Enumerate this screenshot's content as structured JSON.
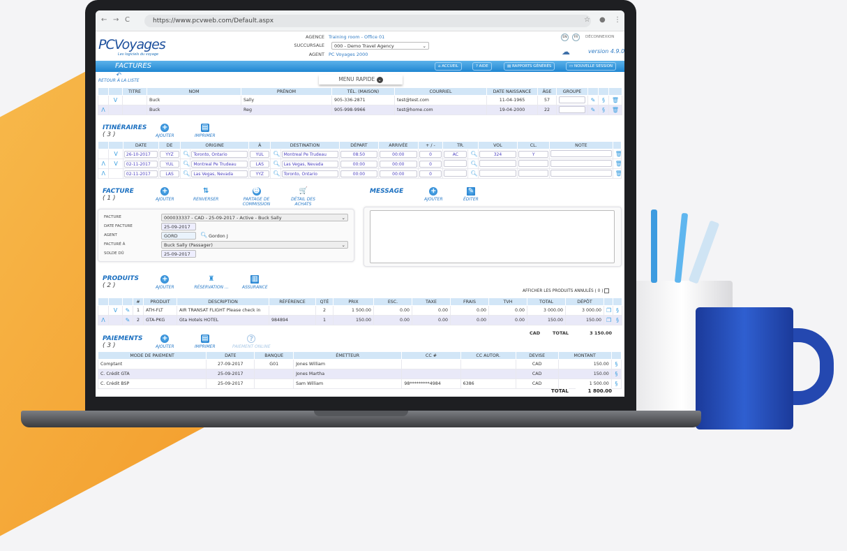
{
  "browser": {
    "url": "https://www.pcvweb.com/Default.aspx"
  },
  "header": {
    "logo": "PCVoyages",
    "tagline": "Les logiciels du voyage",
    "agence_label": "AGENCE",
    "agence": "Training room - Office 01",
    "succursale_label": "SUCCURSALE",
    "succursale": "000 - Demo Travel Agency",
    "agent_label": "AGENT",
    "agent": "PC Voyages 2000",
    "lang_en": "EN",
    "lang_fr": "FR",
    "logout": "DÉCONNEXION",
    "version": "version 4.9.0"
  },
  "bar": {
    "title": "FACTURES",
    "accueil": "ACCUEIL",
    "aide": "AIDE",
    "rapports": "RAPPORTS GÉNÉRÉS",
    "session": "NOUVELLE SESSION"
  },
  "back": "RETOUR À LA LISTE",
  "menu_rapide": "MENU RAPIDE",
  "passengers": {
    "headers": [
      "TITRE",
      "NOM",
      "PRÉNOM",
      "TÉL. (MAISON)",
      "COURRIEL",
      "DATE NAISSANCE",
      "ÂGE",
      "GROUPE"
    ],
    "rows": [
      [
        "",
        "Buck",
        "Sally",
        "905-336-2871",
        "test@test.com",
        "11-04-1965",
        "57"
      ],
      [
        "",
        "Buck",
        "Reg",
        "905-998-9966",
        "test@home.com",
        "19-04-2000",
        "22"
      ]
    ]
  },
  "itineraires": {
    "title": "ITINÉRAIRES",
    "count": "( 3 )",
    "add": "AJOUTER",
    "print": "IMPRIMER",
    "headers": [
      "DATE",
      "DE",
      "ORIGINE",
      "À",
      "DESTINATION",
      "DÉPART",
      "ARRIVÉE",
      "+ / -",
      "TR.",
      "VOL",
      "CL.",
      "NOTE"
    ],
    "rows": [
      [
        "26-10-2017",
        "YYZ",
        "Toronto, Ontario",
        "YUL",
        "Montreal Pe Trudeau",
        "08:50",
        "00:00",
        "0",
        "AC",
        "324",
        "Y",
        ""
      ],
      [
        "02-11-2017",
        "YUL",
        "Montreal Pe Trudeau",
        "LAS",
        "Las Vegas, Nevada",
        "00:00",
        "00:00",
        "0",
        "",
        "",
        "",
        ""
      ],
      [
        "02-11-2017",
        "LAS",
        "Las Vegas, Nevada",
        "YYZ",
        "Toronto, Ontario",
        "00:00",
        "00:00",
        "0",
        "",
        "",
        "",
        ""
      ]
    ]
  },
  "facture": {
    "title": "FACTURE",
    "count": "( 1 )",
    "add": "AJOUTER",
    "reverse": "RENVERSER",
    "commission": "PARTAGE DE COMMISSION",
    "details": "DÉTAIL DES ACHATS",
    "facture_label": "FACTURE",
    "facture": "000033337 - CAD - 25-09-2017 - Active - Buck Sally",
    "date_label": "DATE FACTURE",
    "date": "25-09-2017",
    "agent_label": "AGENT",
    "agent_code": "GORD",
    "agent_name": "Gordon J",
    "factura_label": "FACTURÉ À",
    "factura": "Buck Sally (Passager)",
    "solde_label": "SOLDE DÛ",
    "solde": "25-09-2017"
  },
  "message": {
    "title": "MESSAGE",
    "add": "AJOUTER",
    "edit": "ÉDITER"
  },
  "produits": {
    "title": "PRODUITS",
    "count": "( 2 )",
    "add": "AJOUTER",
    "reservation": "RÉSERVATION ...",
    "assurance": "ASSURANCE",
    "show_cancelled": "AFFICHER LES PRODUITS ANNULÉS ( 0 )",
    "headers": [
      "#",
      "PRODUIT",
      "DESCRIPTION",
      "RÉFÉRENCE",
      "QTÉ",
      "PRIX",
      "ESC.",
      "TAXE",
      "FRAIS",
      "TVH",
      "TOTAL",
      "DÉPÔT"
    ],
    "rows": [
      [
        "1",
        "ATH-FLT",
        "AIR TRANSAT FLIGHT Please check in",
        "",
        "2",
        "1 500.00",
        "0.00",
        "0.00",
        "0.00",
        "0.00",
        "3 000.00",
        "3 000.00"
      ],
      [
        "2",
        "GTA-PKG",
        "Gta Hotels HOTEL",
        "984894",
        "1",
        "150.00",
        "0.00",
        "0.00",
        "0.00",
        "0.00",
        "150.00",
        "150.00"
      ]
    ],
    "currency": "CAD",
    "total_label": "TOTAL",
    "total": "3 150.00"
  },
  "paiements": {
    "title": "PAIEMENTS",
    "count": "( 3 )",
    "add": "AJOUTER",
    "print": "IMPRIMER",
    "online": "PAIEMENT ONLINE",
    "headers": [
      "MODE DE PAIEMENT",
      "DATE",
      "BANQUE",
      "ÉMETTEUR",
      "CC #",
      "CC AUTOR.",
      "DEVISE",
      "MONTANT"
    ],
    "rows": [
      [
        "Comptant",
        "27-09-2017",
        "G01",
        "Jones William",
        "",
        "",
        "CAD",
        "150.00"
      ],
      [
        "C. Crédit GTA",
        "25-09-2017",
        "",
        "Jones Martha",
        "",
        "",
        "CAD",
        "150.00"
      ],
      [
        "C. Crédit BSP",
        "25-09-2017",
        "",
        "Sam William",
        "98*********4984",
        "6386",
        "CAD",
        "1 500.00"
      ]
    ],
    "total_label": "TOTAL",
    "total": "1 800.00"
  }
}
